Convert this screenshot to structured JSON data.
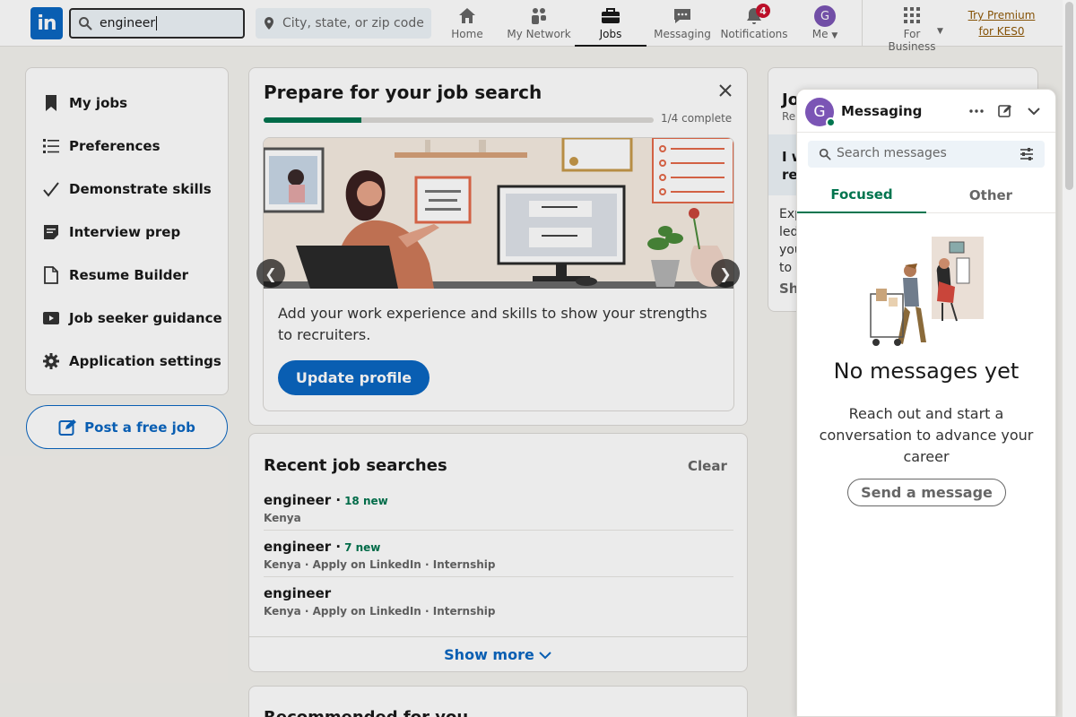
{
  "nav": {
    "logo_text": "in",
    "search_value": "engineer",
    "location_placeholder": "City, state, or zip code",
    "items": [
      {
        "label": "Home",
        "icon": "home-icon"
      },
      {
        "label": "My Network",
        "icon": "network-icon"
      },
      {
        "label": "Jobs",
        "icon": "briefcase-icon"
      },
      {
        "label": "Messaging",
        "icon": "messaging-icon"
      },
      {
        "label": "Notifications",
        "icon": "bell-icon",
        "badge": "4"
      },
      {
        "label": "Me",
        "icon": "avatar",
        "avatar_letter": "G"
      }
    ],
    "business_label_1": "For",
    "business_label_2": "Business",
    "premium_line_1": "Try Premium",
    "premium_line_2": "for KES0"
  },
  "sidebar": {
    "items": [
      {
        "label": "My jobs",
        "icon": "bookmark-icon"
      },
      {
        "label": "Preferences",
        "icon": "list-icon"
      },
      {
        "label": "Demonstrate skills",
        "icon": "checkmark-icon"
      },
      {
        "label": "Interview prep",
        "icon": "notes-icon"
      },
      {
        "label": "Resume Builder",
        "icon": "document-icon"
      },
      {
        "label": "Job seeker guidance",
        "icon": "video-icon"
      },
      {
        "label": "Application settings",
        "icon": "gear-icon"
      }
    ],
    "post_job": "Post a free job"
  },
  "prepare": {
    "title": "Prepare for your job search",
    "progress_text": "1/4 complete",
    "progress_fraction": 0.25,
    "description": "Add your work experience and skills to show your strengths to recruiters.",
    "button": "Update profile",
    "prev_arrow": "❮",
    "next_arrow": "❯"
  },
  "recent": {
    "title": "Recent job searches",
    "clear": "Clear",
    "searches": [
      {
        "title": "engineer ·",
        "new": "18 new",
        "sub": "Kenya"
      },
      {
        "title": "engineer ·",
        "new": "7 new",
        "sub": "Kenya · Apply on LinkedIn · Internship"
      },
      {
        "title": "engineer",
        "new": "",
        "sub": "Kenya · Apply on LinkedIn · Internship"
      }
    ],
    "show_more": "Show more"
  },
  "recommended": {
    "title": "Recommended for you"
  },
  "rightcard": {
    "title": "Jo",
    "subtitle": "Re",
    "highlight_1": "I w",
    "highlight_2": "re",
    "body": [
      "Exp",
      "led",
      "you",
      "to l"
    ],
    "show": "Sh"
  },
  "messaging": {
    "avatar_letter": "G",
    "title": "Messaging",
    "search_placeholder": "Search messages",
    "tab_focused": "Focused",
    "tab_other": "Other",
    "empty_title": "No messages yet",
    "empty_body": "Reach out and start a conversation to advance your career",
    "send_button": "Send a message"
  },
  "colors": {
    "brand": "#0a66c2",
    "success": "#01754f",
    "premium": "#915907",
    "badge": "#cb112d",
    "avatar": "#7b55b5"
  }
}
